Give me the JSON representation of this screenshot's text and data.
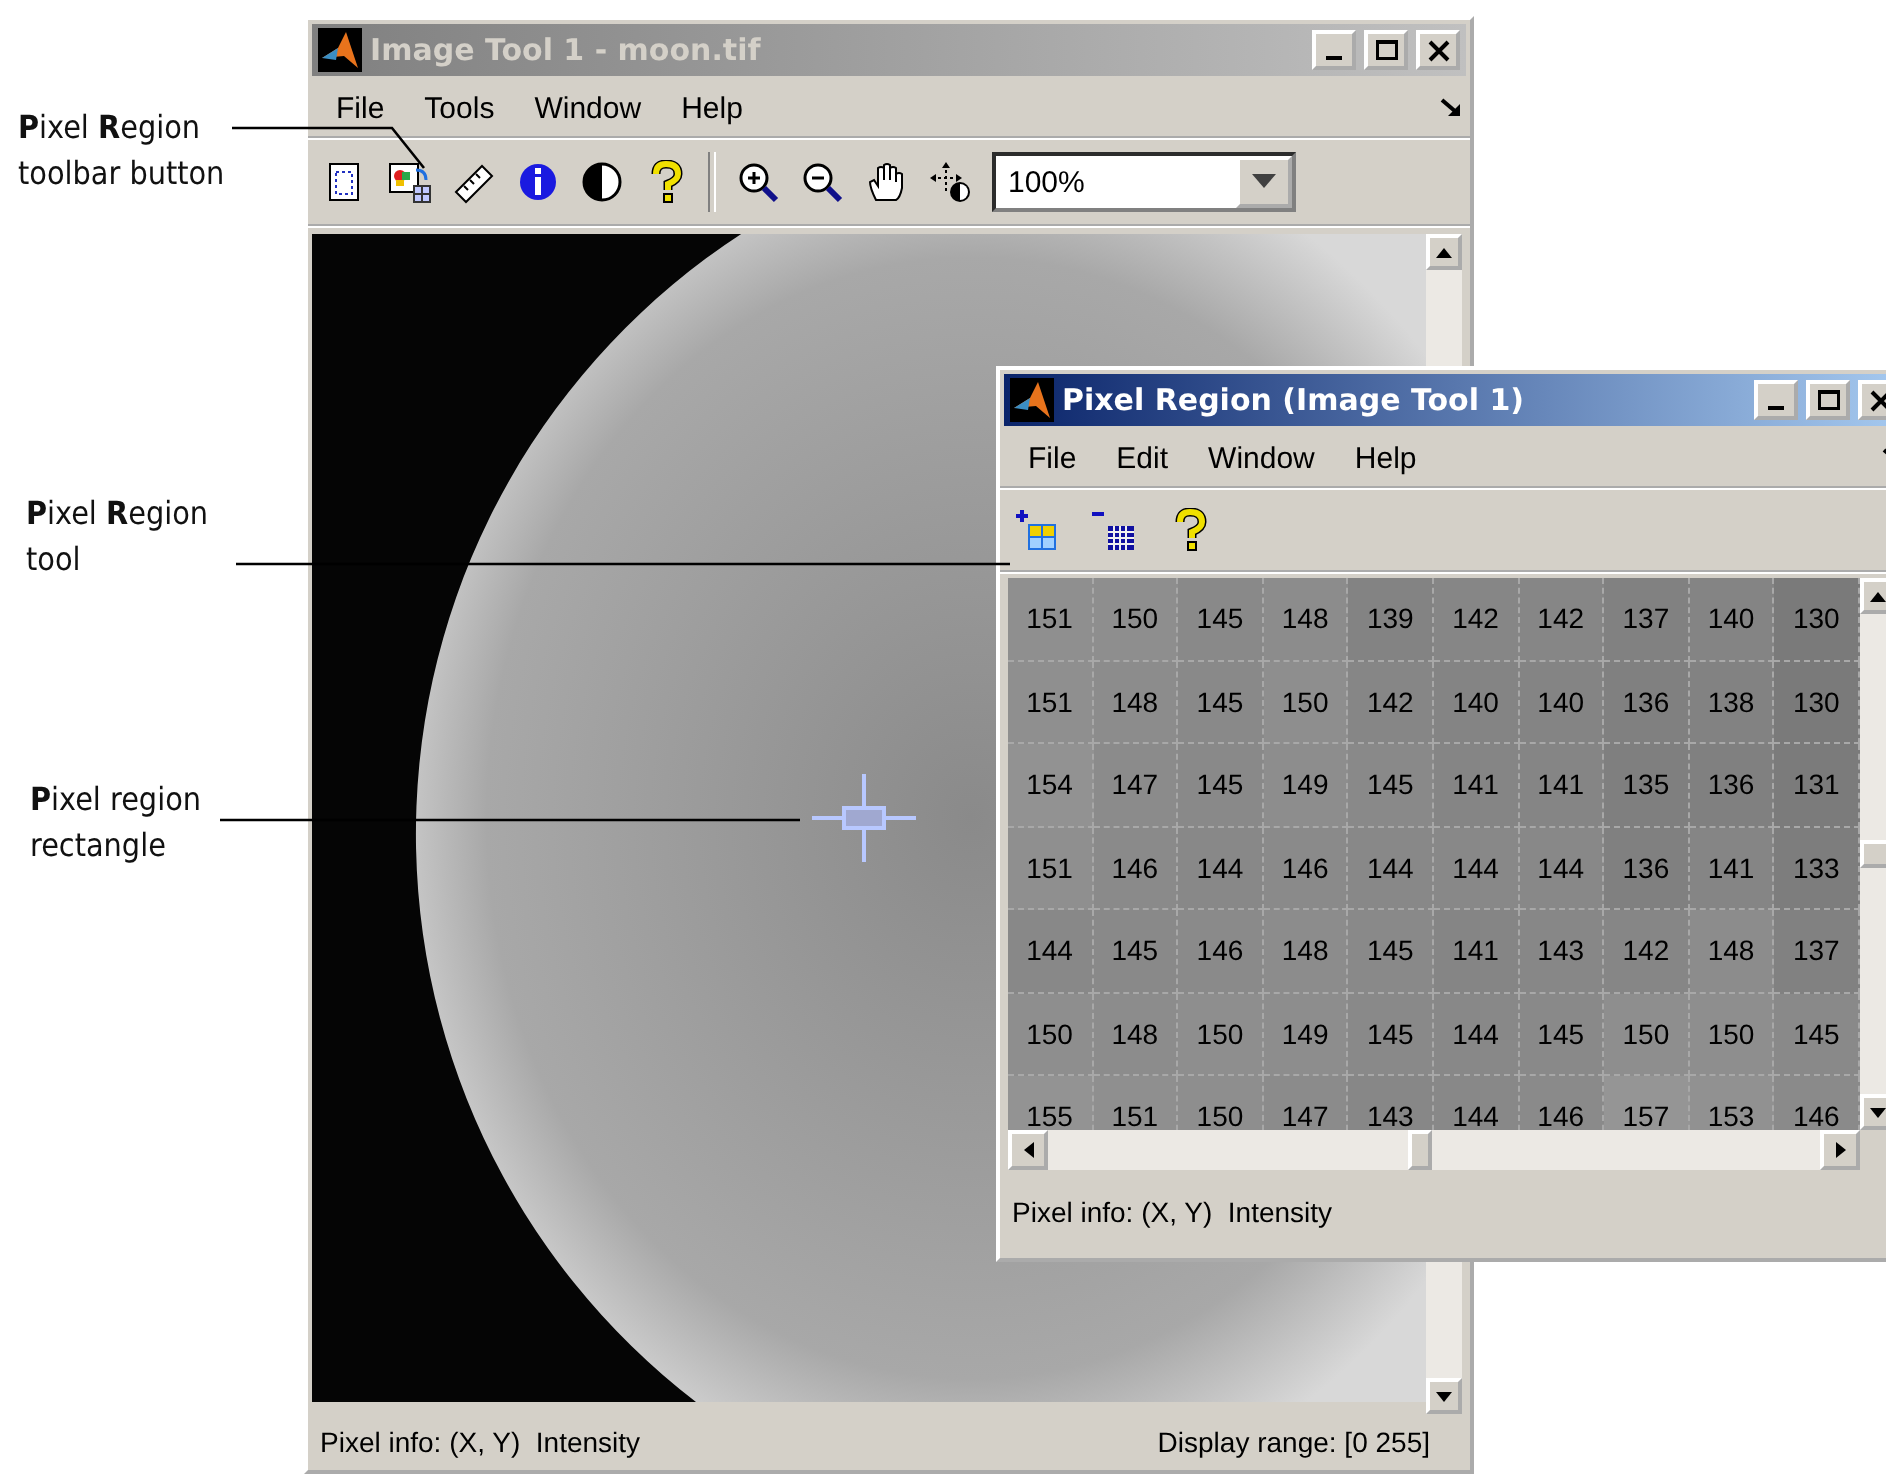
{
  "callouts": [
    {
      "text": "**P**ixel **R**egion toolbar button"
    },
    {
      "text": "**P**ixel **R**egion tool"
    },
    {
      "text": "**P**ixel region rectangle"
    }
  ],
  "image_tool": {
    "title": "Image Tool 1 - moon.tif",
    "active": false,
    "menu": [
      "File",
      "Tools",
      "Window",
      "Help"
    ],
    "magnification": "100%",
    "status_left": "Pixel info: (X, Y)  Intensity",
    "status_right": "Display range: [0 255]"
  },
  "pixel_region": {
    "title": "Pixel Region (Image Tool 1)",
    "active": true,
    "menu": [
      "File",
      "Edit",
      "Window",
      "Help"
    ],
    "rows": [
      [
        "151",
        "150",
        "145",
        "148",
        "139",
        "142",
        "142",
        "137",
        "140",
        "130"
      ],
      [
        "151",
        "148",
        "145",
        "150",
        "142",
        "140",
        "140",
        "136",
        "138",
        "130"
      ],
      [
        "154",
        "147",
        "145",
        "149",
        "145",
        "141",
        "141",
        "135",
        "136",
        "131"
      ],
      [
        "151",
        "146",
        "144",
        "146",
        "144",
        "144",
        "144",
        "136",
        "141",
        "133"
      ],
      [
        "144",
        "145",
        "146",
        "148",
        "145",
        "141",
        "143",
        "142",
        "148",
        "137"
      ],
      [
        "150",
        "148",
        "150",
        "149",
        "145",
        "144",
        "145",
        "150",
        "150",
        "145"
      ],
      [
        "155",
        "151",
        "150",
        "147",
        "143",
        "144",
        "146",
        "157",
        "153",
        "146"
      ]
    ],
    "status": "Pixel info: (X, Y)  Intensity"
  }
}
